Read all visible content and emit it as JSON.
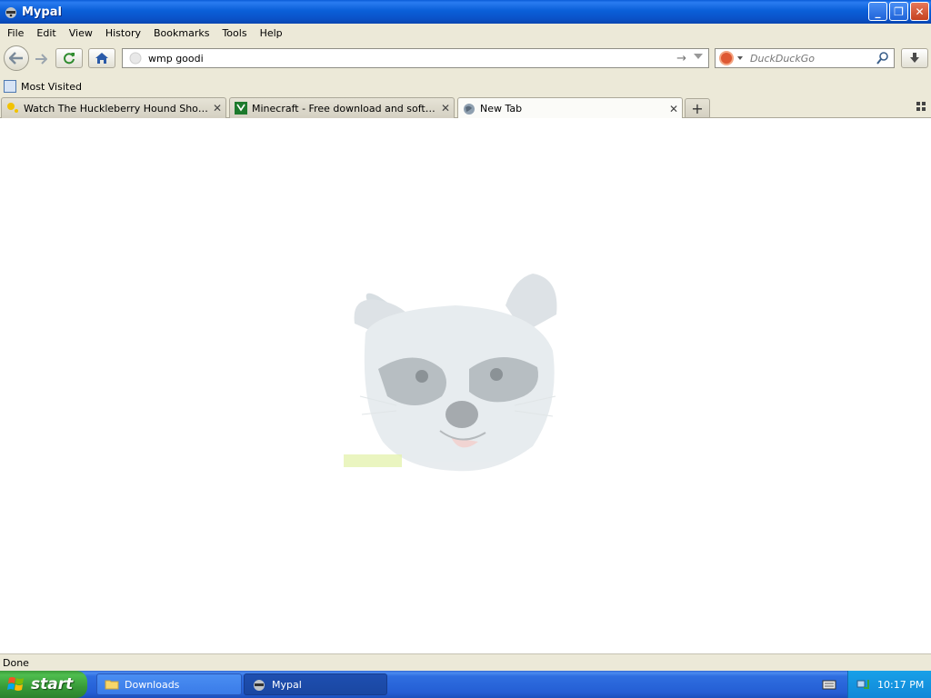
{
  "window": {
    "title": "Mypal",
    "minimize_label": "_",
    "maximize_label": "❐",
    "close_label": "✕"
  },
  "menu": {
    "items": [
      {
        "label": "File"
      },
      {
        "label": "Edit"
      },
      {
        "label": "View"
      },
      {
        "label": "History"
      },
      {
        "label": "Bookmarks"
      },
      {
        "label": "Tools"
      },
      {
        "label": "Help"
      }
    ]
  },
  "navbar": {
    "url_value": "wmp goodi",
    "search_placeholder": "DuckDuckGo",
    "search_engine_icon": "duckduckgo-icon"
  },
  "bookmarks": {
    "items": [
      {
        "label": "Most Visited"
      }
    ]
  },
  "tabs": [
    {
      "label": "Watch The Huckleberry Hound Show Epis...",
      "icon": "huckleberry-favicon-icon",
      "active": false
    },
    {
      "label": "Minecraft - Free download and software ...",
      "icon": "minecraft-favicon-icon",
      "active": false
    },
    {
      "label": "New Tab",
      "icon": "globe-icon",
      "active": true
    }
  ],
  "newtab_label": "+",
  "status": {
    "text": "Done"
  },
  "taskbar": {
    "start_label": "start",
    "tasks": [
      {
        "label": "Downloads",
        "icon": "folder-icon"
      },
      {
        "label": "Mypal",
        "icon": "mypal-icon"
      }
    ],
    "clock": "10:17 PM"
  },
  "colors": {
    "titlebar": "#0a5bd6",
    "taskbar": "#245ed4",
    "start": "#379a37",
    "tray": "#1088d8"
  }
}
